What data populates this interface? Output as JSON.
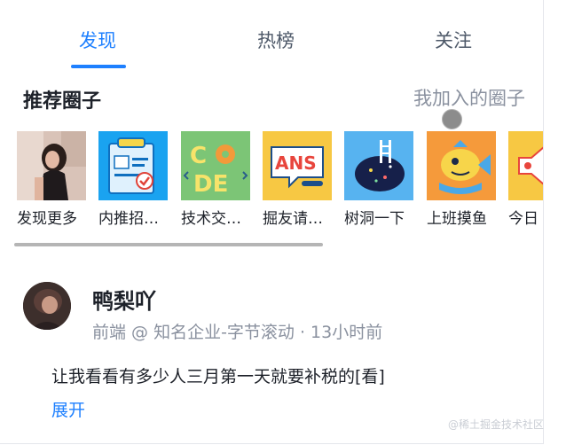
{
  "tabs": [
    {
      "label": "发现",
      "active": true
    },
    {
      "label": "热榜",
      "active": false
    },
    {
      "label": "关注",
      "active": false
    }
  ],
  "section": {
    "title": "推荐圈子",
    "joined_link": "我加入的圈子"
  },
  "circles": [
    {
      "name": "发现更多",
      "icon": "photo-girl"
    },
    {
      "name": "内推招…",
      "icon": "resume-icon"
    },
    {
      "name": "技术交…",
      "icon": "code-icon"
    },
    {
      "name": "掘友请…",
      "icon": "ans-icon"
    },
    {
      "name": "树洞一下",
      "icon": "tree-hole-icon"
    },
    {
      "name": "上班摸鱼",
      "icon": "fish-icon"
    },
    {
      "name": "今日",
      "icon": "speaker-icon"
    }
  ],
  "post": {
    "author": "鸭梨吖",
    "meta": "前端 @ 知名企业-字节滚动 · 13小时前",
    "content": "让我看看有多少人三月第一天就要补税的[看]",
    "expand_label": "展开"
  },
  "watermark": "@稀土掘金技术社区",
  "colors": {
    "accent": "#1e80ff",
    "text": "#1d2129",
    "muted": "#8a919f"
  }
}
